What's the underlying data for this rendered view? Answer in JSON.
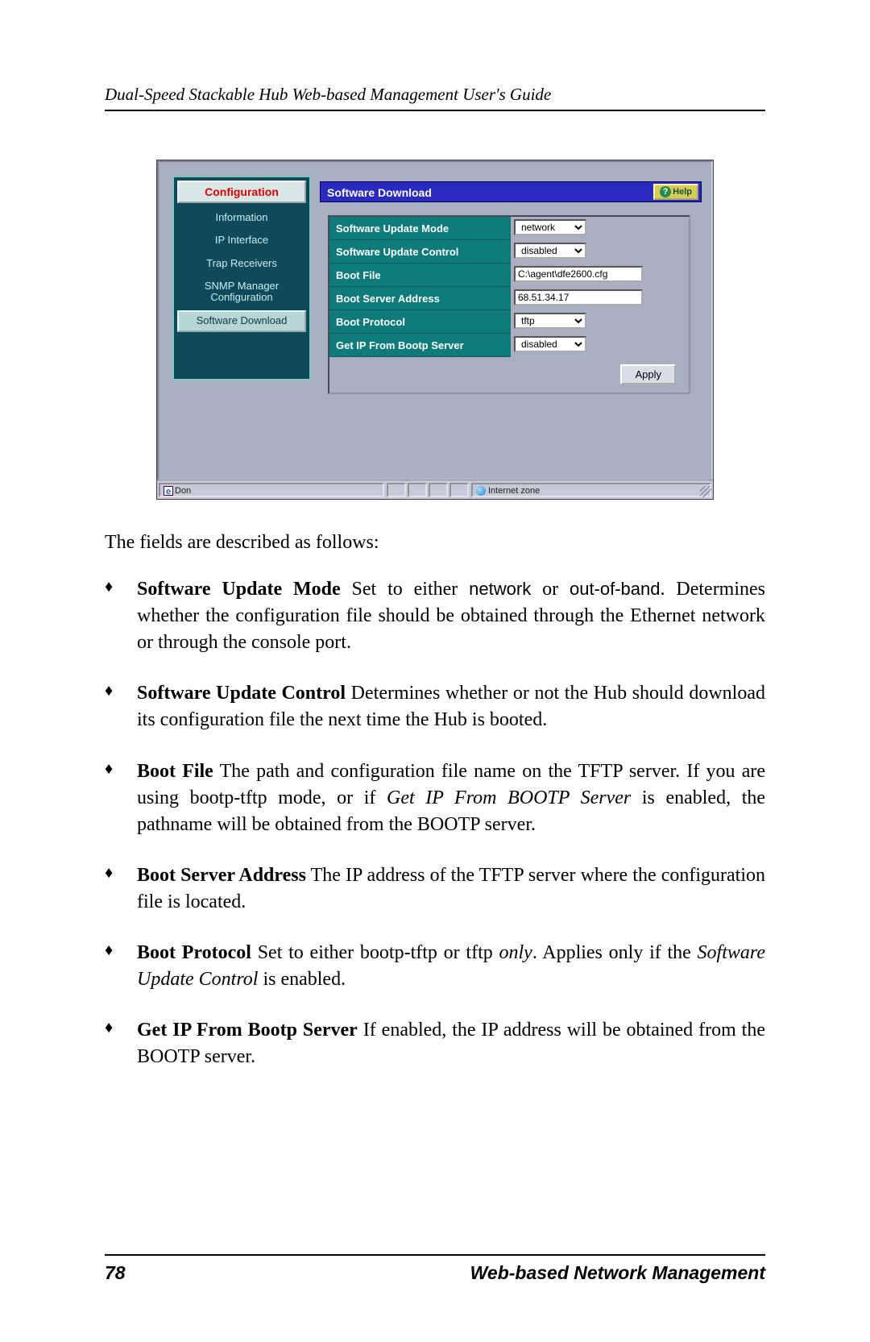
{
  "header": {
    "title": "Dual-Speed Stackable Hub Web-based Management User's Guide"
  },
  "screenshot": {
    "sidebar": {
      "title": "Configuration",
      "items": [
        {
          "label": "Information",
          "selected": false
        },
        {
          "label": "IP Interface",
          "selected": false
        },
        {
          "label": "Trap Receivers",
          "selected": false
        },
        {
          "label": "SNMP Manager Configuration",
          "selected": false
        },
        {
          "label": "Software Download",
          "selected": true
        }
      ]
    },
    "panel": {
      "title": "Software Download",
      "help": "Help",
      "rows": [
        {
          "label": "Software Update Mode",
          "type": "select",
          "value": "network"
        },
        {
          "label": "Software Update Control",
          "type": "select",
          "value": "disabled"
        },
        {
          "label": "Boot File",
          "type": "text",
          "value": "C:\\agent\\dfe2600.cfg"
        },
        {
          "label": "Boot Server Address",
          "type": "text",
          "value": "68.51.34.17"
        },
        {
          "label": "Boot Protocol",
          "type": "select",
          "value": "tftp"
        },
        {
          "label": "Get IP From Bootp Server",
          "type": "select",
          "value": "disabled"
        }
      ],
      "apply": "Apply"
    },
    "status": {
      "left": "Don",
      "zone": "Internet zone"
    }
  },
  "intro": "The fields are described as follows:",
  "bullets": [
    {
      "term": "Software Update Mode",
      "pre": "   Set to either ",
      "sans1": "network",
      "mid1": " or ",
      "sans2": "out-of-band",
      "rest": ". Determines whether the configuration file should be obtained through the Ethernet network or through the console port."
    },
    {
      "term": "Software Update Control",
      "rest": "    Determines whether or not the Hub should download its configuration file the next time the Hub is booted."
    },
    {
      "term": "Boot File",
      "pre": "    The path and configuration file name on the TFTP server.  If you are using bootp-tftp mode, or if ",
      "ital1": "Get IP From BOOTP Server",
      "rest": " is enabled, the pathname will be obtained from the BOOTP server."
    },
    {
      "term": "Boot Server Address",
      "rest": "     The IP address of the TFTP server where the configuration file is located."
    },
    {
      "term": "Boot Protocol",
      "pre": "    Set to either bootp-tftp or tftp ",
      "ital1": "only",
      "mid1": ".  Applies only if the ",
      "ital2": "Software Update Control",
      "rest": " is enabled."
    },
    {
      "term": "Get IP From Bootp Server",
      "rest": "    If enabled, the IP address will be obtained from the BOOTP server."
    }
  ],
  "footer": {
    "page": "78",
    "section": "Web-based Network Management"
  }
}
